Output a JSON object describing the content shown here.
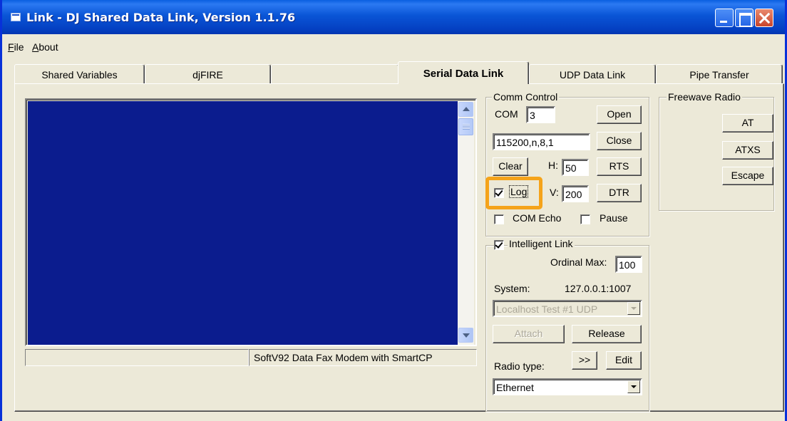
{
  "window": {
    "title": "Link - DJ Shared Data Link, Version 1.1.76",
    "controls": [
      "minimize-icon",
      "maximize-icon",
      "close-icon"
    ],
    "colors": {
      "titlebar": "#0a55d6",
      "face": "#ece9d8",
      "terminal": "#0b1c8e",
      "highlight": "#f5a31a"
    }
  },
  "menu": {
    "file": "File",
    "about": "About"
  },
  "tabs": [
    {
      "label": "Shared Variables",
      "active": false
    },
    {
      "label": "djFIRE",
      "active": false
    },
    {
      "label": "",
      "active": false
    },
    {
      "label": "Serial Data Link",
      "active": true
    },
    {
      "label": "UDP Data Link",
      "active": false
    },
    {
      "label": "Pipe Transfer",
      "active": false
    }
  ],
  "status": {
    "left": "",
    "right": "SoftV92 Data Fax Modem with SmartCP"
  },
  "comm_control": {
    "legend": "Comm Control",
    "com_label": "COM",
    "com_value": "3",
    "settings_value": "115200,n,8,1",
    "open_label": "Open",
    "close_label": "Close",
    "clear_label": "Clear",
    "h_label": "H:",
    "h_value": "50",
    "rts_label": "RTS",
    "log_label": "Log",
    "log_checked": true,
    "v_label": "V:",
    "v_value": "200",
    "dtr_label": "DTR",
    "com_echo_label": "COM Echo",
    "com_echo_checked": false,
    "pause_label": "Pause",
    "pause_checked": false
  },
  "intelligent_link": {
    "legend": "Intelligent Link",
    "checked": true,
    "ordinal_max_label": "Ordinal Max:",
    "ordinal_max_value": "100",
    "system_label": "System:",
    "system_value": "127.0.0.1:1007",
    "system_select": "Localhost Test #1 UDP",
    "attach_label": "Attach",
    "release_label": "Release",
    "radio_type_label": "Radio type:",
    "more_label": ">>",
    "edit_label": "Edit",
    "radio_type_value": "Ethernet"
  },
  "freewave": {
    "legend": "Freewave Radio",
    "at_label": "AT",
    "atxs_label": "ATXS",
    "escape_label": "Escape"
  }
}
